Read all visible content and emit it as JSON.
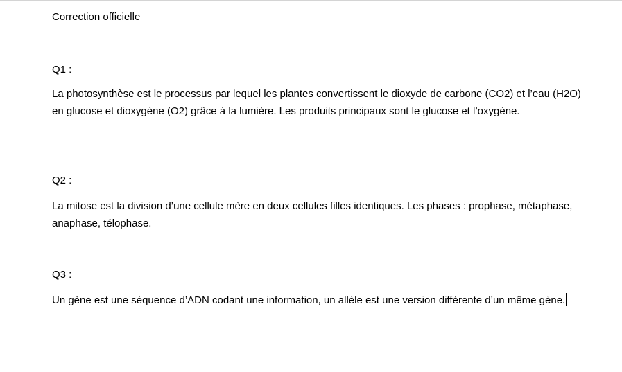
{
  "document": {
    "title": "Correction officielle",
    "questions": [
      {
        "label": "Q1 :",
        "answer": "La photosynthèse est le processus par lequel les plantes convertissent le dioxyde de carbone (CO2) et l’eau (H2O) en glucose et dioxygène (O2) grâce à la lumière. Les produits principaux sont le glucose et l’oxygène."
      },
      {
        "label": "Q2 :",
        "answer": "La mitose est la division d’une cellule mère en deux cellules filles identiques. Les phases : prophase, métaphase, anaphase, télophase."
      },
      {
        "label": "Q3 :",
        "answer": "Un gène est une séquence d’ADN codant une information, un allèle est une version différente d’un même gène."
      }
    ]
  }
}
